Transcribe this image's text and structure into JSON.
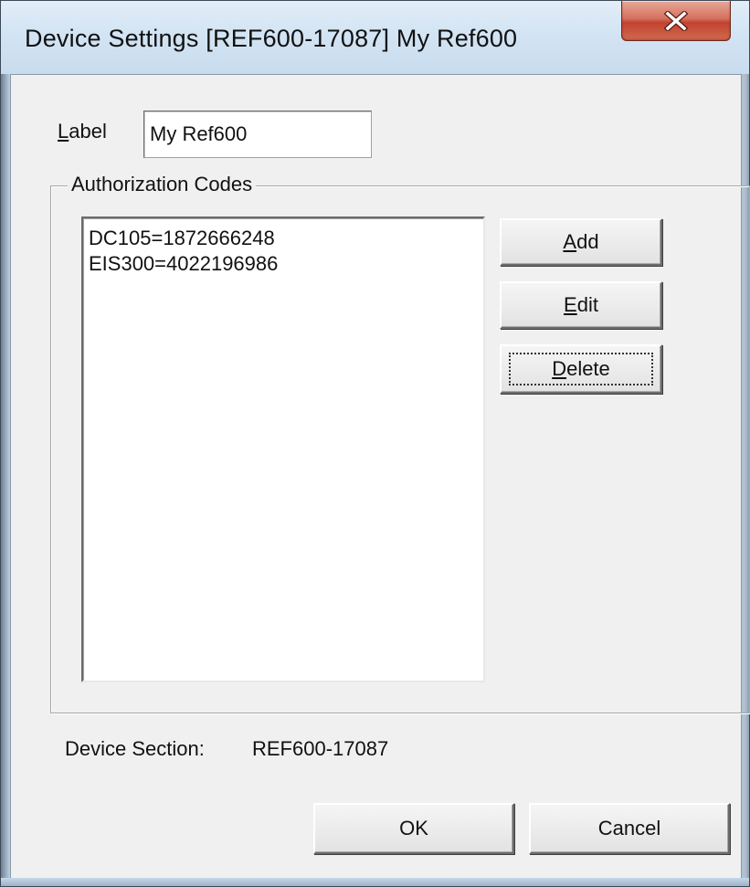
{
  "window": {
    "title": "Device Settings [REF600-17087] My Ref600"
  },
  "label_field": {
    "label_prefix": "",
    "label_mnemonic": "L",
    "label_rest": "abel",
    "value": "My Ref600"
  },
  "auth_codes": {
    "group_title": "Authorization Codes",
    "items": [
      "DC105=1872666248",
      "EIS300=4022196986"
    ]
  },
  "buttons": {
    "add": {
      "mnemonic": "A",
      "rest": "dd"
    },
    "edit": {
      "mnemonic": "E",
      "rest": "dit"
    },
    "delete": {
      "mnemonic": "D",
      "rest": "elete"
    },
    "ok": "OK",
    "cancel": "Cancel"
  },
  "device_section": {
    "label": "Device Section:",
    "value": "REF600-17087"
  },
  "icons": {
    "close": "close-icon"
  },
  "colors": {
    "close_button": "#c2432f",
    "dialog_face": "#f0f0f0",
    "frame": "#c9dced"
  }
}
